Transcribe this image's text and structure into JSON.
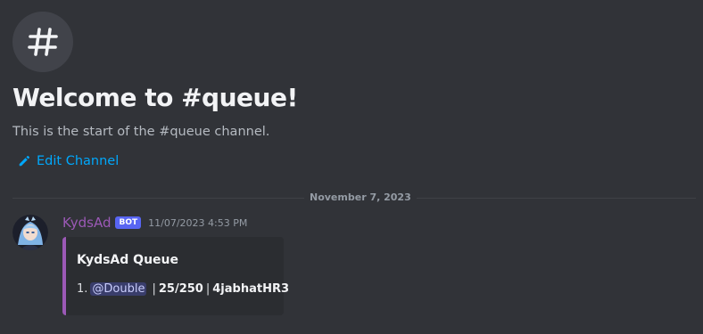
{
  "channel": {
    "icon": "hash-icon",
    "welcome_title": "Welcome to #queue!",
    "welcome_subtitle": "This is the start of the #queue channel.",
    "edit_label": "Edit Channel"
  },
  "divider": {
    "date": "November 7, 2023"
  },
  "message": {
    "username": "KydsAd",
    "username_color": "#9b59b6",
    "bot_tag": "BOT",
    "timestamp": "11/07/2023 4:53 PM",
    "embed": {
      "accent_color": "#9b59b6",
      "title": "KydsAd Queue",
      "entries": [
        {
          "index": "1.",
          "mention": "@Double",
          "count": "25/250",
          "code": "4jabhatHR3"
        }
      ]
    }
  },
  "colors": {
    "background": "#313338",
    "link": "#00a8fc",
    "bot_tag_bg": "#5865f2"
  }
}
